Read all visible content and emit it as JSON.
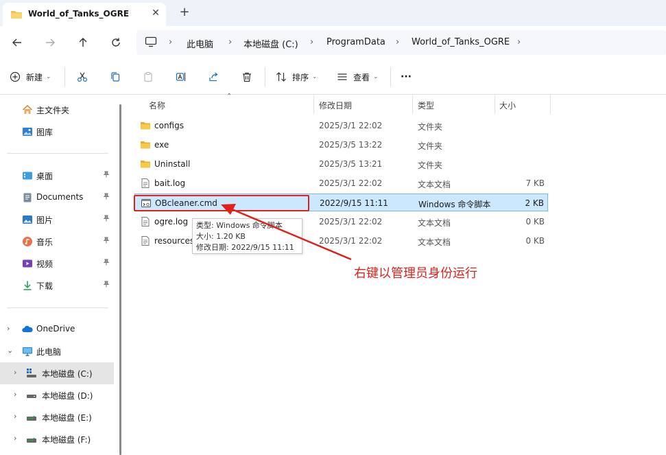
{
  "window": {
    "tab_title": "World_of_Tanks_OGRE",
    "tab_close": "✕",
    "new_tab": "+"
  },
  "address": {
    "breadcrumbs": [
      "此电脑",
      "本地磁盘 (C:)",
      "ProgramData",
      "World_of_Tanks_OGRE"
    ],
    "separator": "›"
  },
  "toolbar": {
    "new_label": "新建",
    "sort_label": "排序",
    "view_label": "查看",
    "more_label": "···"
  },
  "sidebar": {
    "items": [
      {
        "label": "主文件夹",
        "icon": "home-icon"
      },
      {
        "label": "图库",
        "icon": "gallery-icon"
      },
      {
        "label": "桌面",
        "icon": "desktop-icon",
        "pinned": true
      },
      {
        "label": "Documents",
        "icon": "documents-icon",
        "pinned": true
      },
      {
        "label": "图片",
        "icon": "pictures-icon",
        "pinned": true
      },
      {
        "label": "音乐",
        "icon": "music-icon",
        "pinned": true
      },
      {
        "label": "视频",
        "icon": "videos-icon",
        "pinned": true
      },
      {
        "label": "下载",
        "icon": "downloads-icon",
        "pinned": true
      },
      {
        "label": "OneDrive",
        "icon": "onedrive-icon"
      },
      {
        "label": "此电脑",
        "icon": "this-pc-icon"
      },
      {
        "label": "本地磁盘 (C:)",
        "icon": "drive-c-icon"
      },
      {
        "label": "本地磁盘 (D:)",
        "icon": "drive-icon"
      },
      {
        "label": "本地磁盘 (E:)",
        "icon": "drive-icon"
      },
      {
        "label": "本地磁盘 (F:)",
        "icon": "drive-icon"
      }
    ],
    "pin_glyph": "📌",
    "chev_right": "›",
    "chev_down": "⌄"
  },
  "filelist": {
    "columns": [
      "名称",
      "修改日期",
      "类型",
      "大小"
    ],
    "rows": [
      {
        "name": "configs",
        "date": "2025/3/1 22:02",
        "type": "文件夹",
        "size": "",
        "icon": "folder-icon"
      },
      {
        "name": "exe",
        "date": "2025/3/5 13:22",
        "type": "文件夹",
        "size": "",
        "icon": "folder-icon"
      },
      {
        "name": "Uninstall",
        "date": "2025/3/5 13:21",
        "type": "文件夹",
        "size": "",
        "icon": "folder-icon"
      },
      {
        "name": "bait.log",
        "date": "2025/3/1 22:02",
        "type": "文本文档",
        "size": "7 KB",
        "icon": "text-file-icon"
      },
      {
        "name": "OBcleaner.cmd",
        "date": "2022/9/15 11:11",
        "type": "Windows 命令脚本",
        "size": "2 KB",
        "icon": "cmd-file-icon"
      },
      {
        "name": "ogre.log",
        "date": "2025/3/1 22:02",
        "type": "文本文档",
        "size": "0 KB",
        "icon": "text-file-icon"
      },
      {
        "name": "resources",
        "date": "2025/3/1 22:02",
        "type": "文本文档",
        "size": "0 KB",
        "icon": "text-file-icon"
      }
    ]
  },
  "tooltip": {
    "type_line": "类型: Windows 命令脚本",
    "size_line": "大小: 1.20 KB",
    "date_line": "修改日期: 2022/9/15 11:11"
  },
  "annotation": {
    "text": "右键以管理员身份运行",
    "color": "#e0211b"
  },
  "colors": {
    "selection_bg": "#cce8ff",
    "folder": "#f3c243",
    "accent": "#0067c0"
  }
}
